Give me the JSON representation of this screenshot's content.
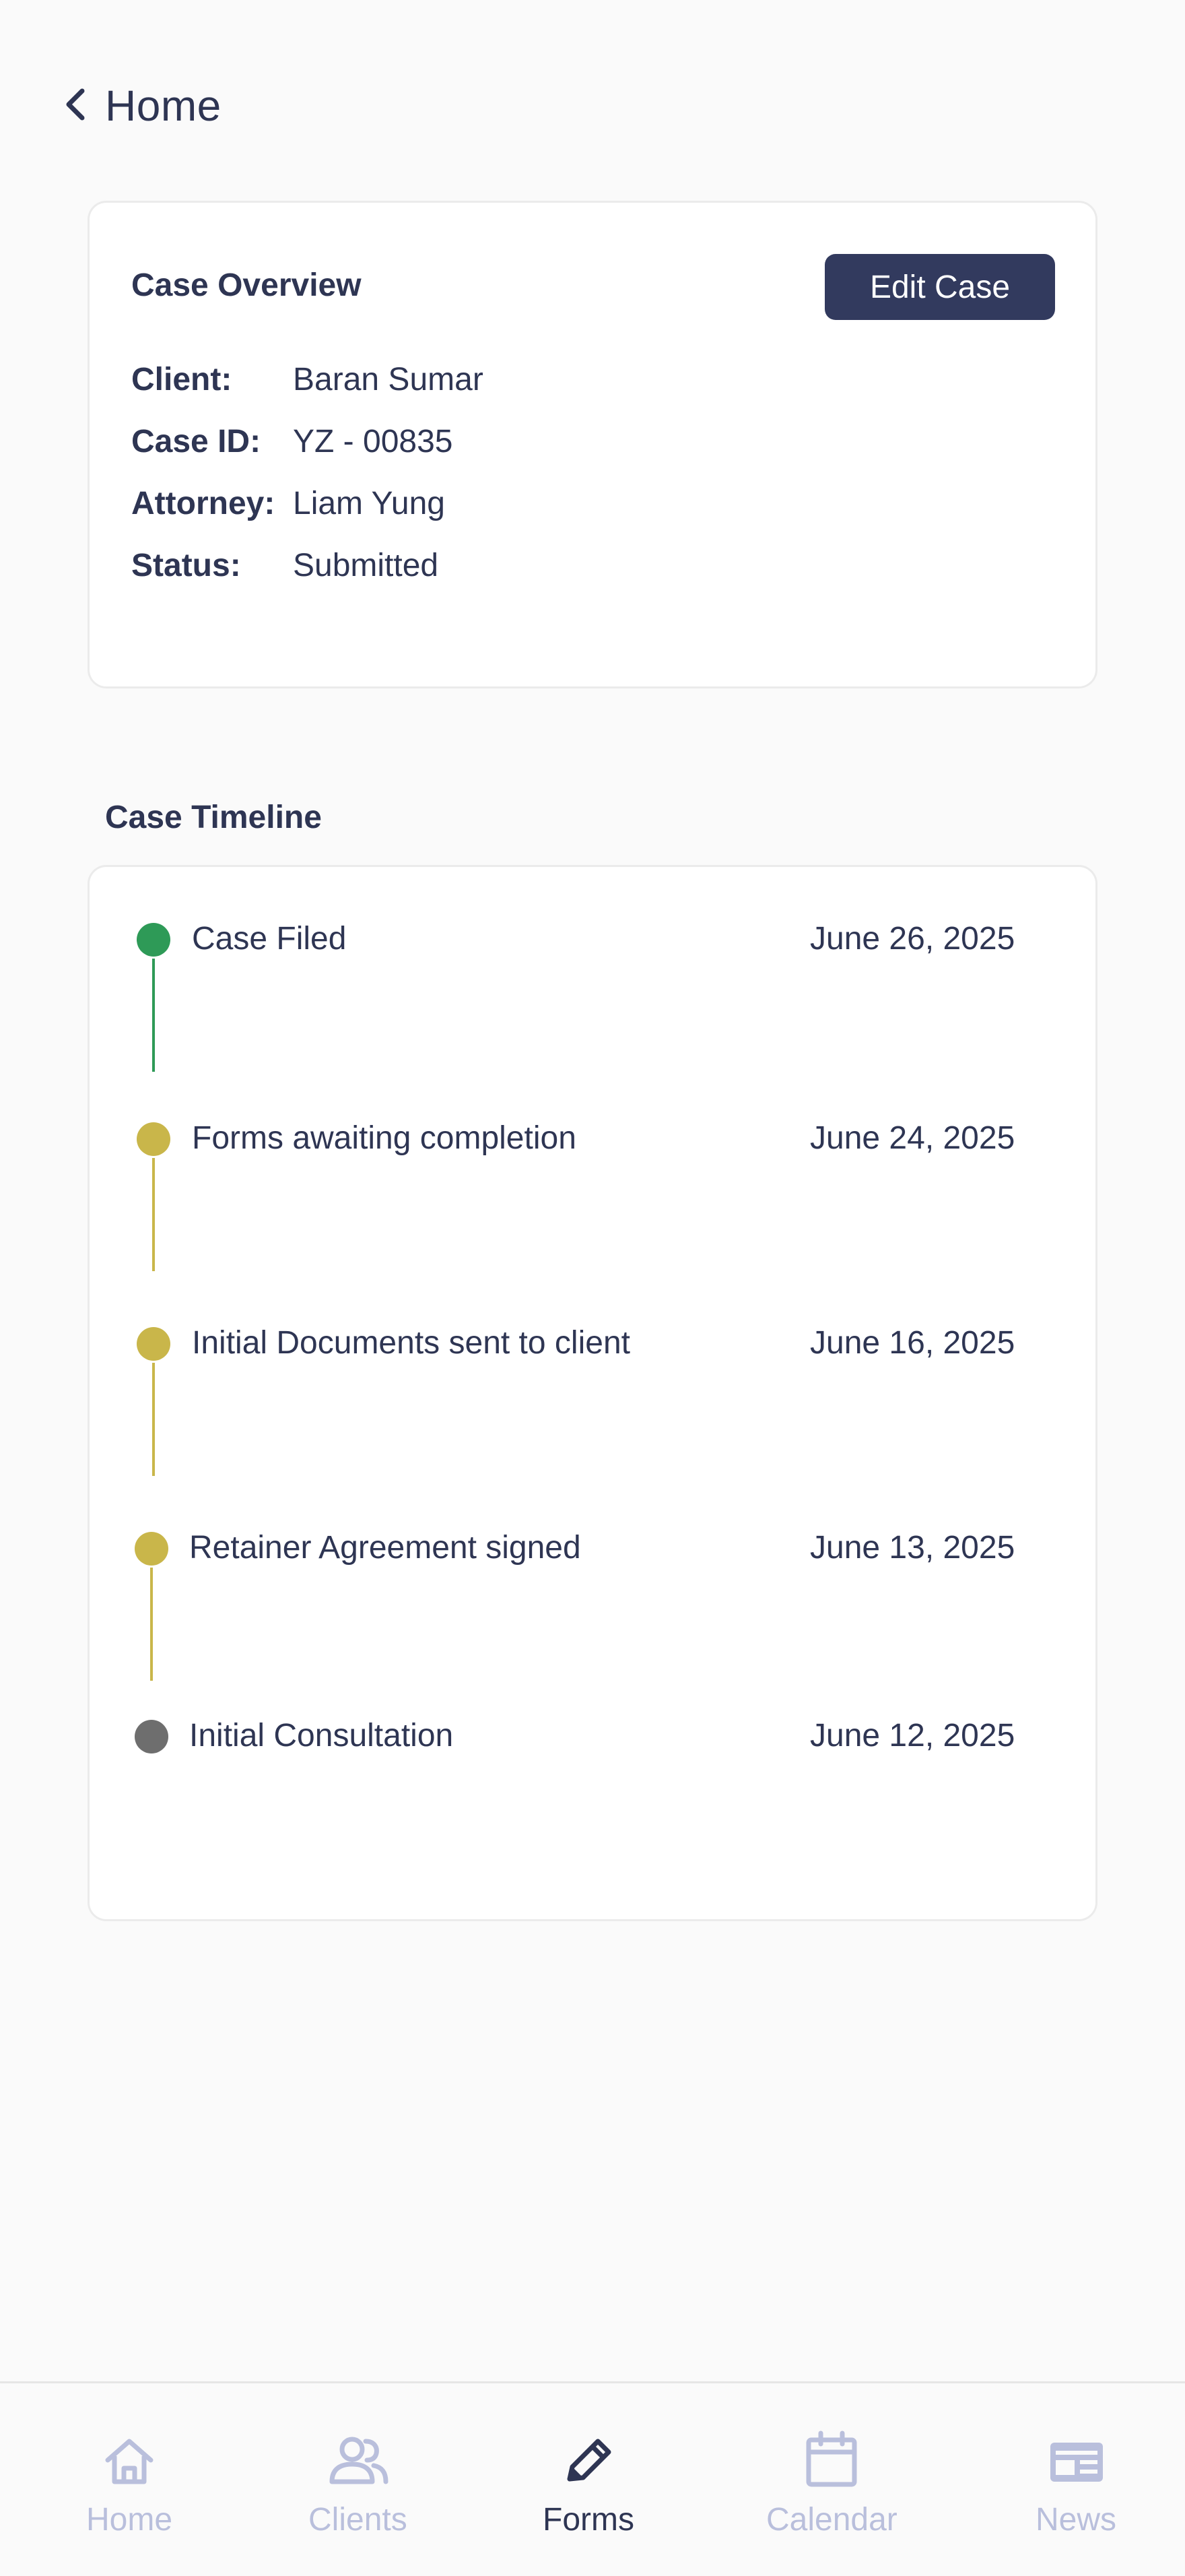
{
  "header": {
    "back_label": "Home"
  },
  "overview": {
    "title": "Case Overview",
    "edit_label": "Edit Case",
    "rows": [
      {
        "key": "Client:",
        "value": "Baran Sumar"
      },
      {
        "key": "Case ID:",
        "value": "YZ - 00835"
      },
      {
        "key": "Attorney:",
        "value": "Liam Yung"
      },
      {
        "key": "Status:",
        "value": "Submitted"
      }
    ]
  },
  "timeline": {
    "title": "Case Timeline",
    "events": [
      {
        "label": "Case Filed",
        "date": "June 26, 2025",
        "status": "complete",
        "color": "#2e9a57"
      },
      {
        "label": "Forms awaiting completion",
        "date": "June 24, 2025",
        "status": "pending",
        "color": "#c9b64a"
      },
      {
        "label": "Initial Documents sent to client",
        "date": "June 16, 2025",
        "status": "pending",
        "color": "#c9b64a"
      },
      {
        "label": "Retainer Agreement signed",
        "date": "June 13, 2025",
        "status": "pending",
        "color": "#c9b64a"
      },
      {
        "label": "Initial Consultation",
        "date": "June 12, 2025",
        "status": "inactive",
        "color": "#6e6e6e"
      }
    ]
  },
  "bottom_nav": {
    "items": [
      {
        "label": "Home",
        "icon": "home-icon",
        "active": false
      },
      {
        "label": "Clients",
        "icon": "clients-icon",
        "active": false
      },
      {
        "label": "Forms",
        "icon": "pencil-icon",
        "active": true
      },
      {
        "label": "Calendar",
        "icon": "calendar-icon",
        "active": false
      },
      {
        "label": "News",
        "icon": "news-icon",
        "active": false
      }
    ]
  },
  "colors": {
    "primary": "#323a5e",
    "text": "#2e3553",
    "inactive_nav": "#b9bfdc",
    "complete": "#2e9a57",
    "pending": "#c9b64a",
    "inactive": "#6e6e6e"
  }
}
